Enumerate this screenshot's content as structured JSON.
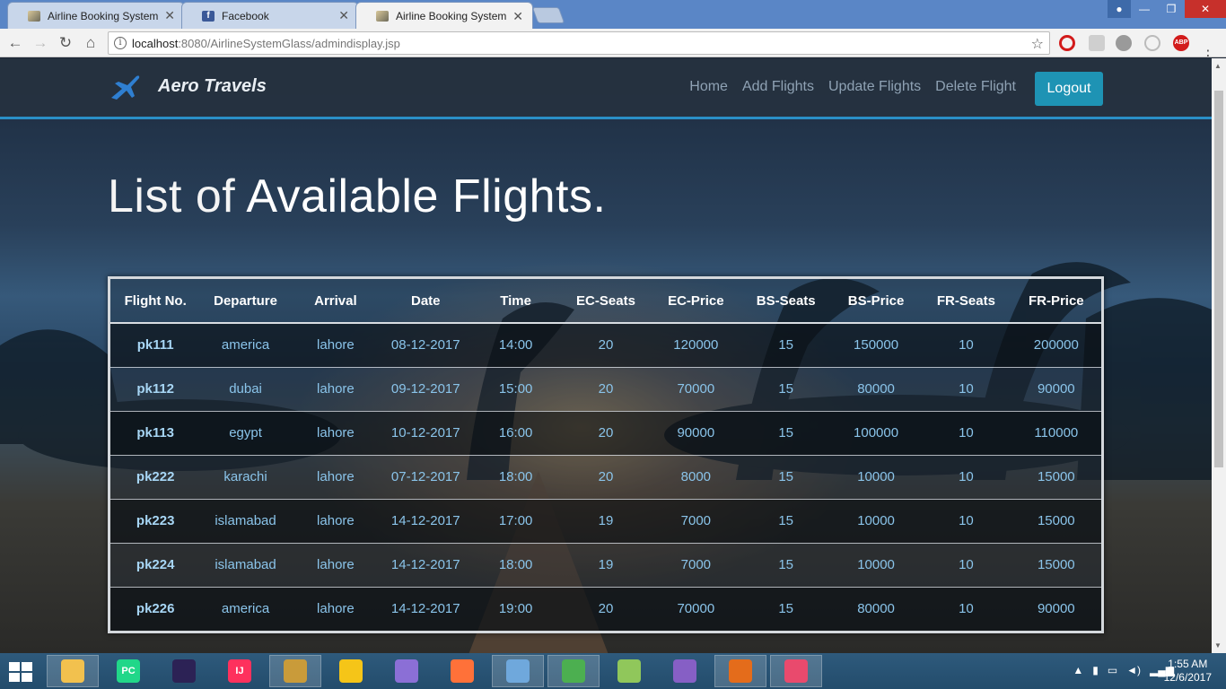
{
  "browser": {
    "tabs": [
      {
        "title": "Airline Booking System",
        "favicon": "plane-favicon",
        "active": false
      },
      {
        "title": "Facebook",
        "favicon": "facebook-favicon",
        "active": false
      },
      {
        "title": "Airline Booking System",
        "favicon": "plane-favicon",
        "active": true
      }
    ],
    "url_host": "localhost",
    "url_rest": ":8080/AirlineSystemGlass/admindisplay.jsp",
    "abp_label": "ABP"
  },
  "site": {
    "brand": "Aero Travels",
    "nav": [
      "Home",
      "Add Flights",
      "Update Flights",
      "Delete Flight"
    ],
    "logout": "Logout",
    "headline_light": "List of ",
    "headline_bold": "Available Flights",
    "headline_end": "."
  },
  "table": {
    "headers": [
      "Flight No.",
      "Departure",
      "Arrival",
      "Date",
      "Time",
      "EC-Seats",
      "EC-Price",
      "BS-Seats",
      "BS-Price",
      "FR-Seats",
      "FR-Price"
    ],
    "rows": [
      [
        "pk111",
        "america",
        "lahore",
        "08-12-2017",
        "14:00",
        "20",
        "120000",
        "15",
        "150000",
        "10",
        "200000"
      ],
      [
        "pk112",
        "dubai",
        "lahore",
        "09-12-2017",
        "15:00",
        "20",
        "70000",
        "15",
        "80000",
        "10",
        "90000"
      ],
      [
        "pk113",
        "egypt",
        "lahore",
        "10-12-2017",
        "16:00",
        "20",
        "90000",
        "15",
        "100000",
        "10",
        "110000"
      ],
      [
        "pk222",
        "karachi",
        "lahore",
        "07-12-2017",
        "18:00",
        "20",
        "8000",
        "15",
        "10000",
        "10",
        "15000"
      ],
      [
        "pk223",
        "islamabad",
        "lahore",
        "14-12-2017",
        "17:00",
        "19",
        "7000",
        "15",
        "10000",
        "10",
        "15000"
      ],
      [
        "pk224",
        "islamabad",
        "lahore",
        "14-12-2017",
        "18:00",
        "19",
        "7000",
        "15",
        "10000",
        "10",
        "15000"
      ],
      [
        "pk226",
        "america",
        "lahore",
        "14-12-2017",
        "19:00",
        "20",
        "70000",
        "15",
        "80000",
        "10",
        "90000"
      ]
    ]
  },
  "taskbar": {
    "apps": [
      {
        "name": "file-explorer",
        "label": "",
        "color": "#f2c14e"
      },
      {
        "name": "pycharm",
        "label": "PC",
        "color": "#21d789"
      },
      {
        "name": "eclipse",
        "label": "",
        "color": "#2c2255"
      },
      {
        "name": "intellij",
        "label": "IJ",
        "color": "#fe315d"
      },
      {
        "name": "tools",
        "label": "",
        "color": "#c99b3a"
      },
      {
        "name": "app-yellow",
        "label": "",
        "color": "#f5c518"
      },
      {
        "name": "app-purple",
        "label": "",
        "color": "#8b6fd6"
      },
      {
        "name": "firefox",
        "label": "",
        "color": "#ff7139"
      },
      {
        "name": "virtualbox",
        "label": "",
        "color": "#6fa8dc"
      },
      {
        "name": "chrome",
        "label": "",
        "color": "#4caf50"
      },
      {
        "name": "notepad-plus",
        "label": "",
        "color": "#90c75b"
      },
      {
        "name": "visual-studio",
        "label": "",
        "color": "#865fc5"
      },
      {
        "name": "matlab",
        "label": "",
        "color": "#e46c1b"
      },
      {
        "name": "star-app",
        "label": "",
        "color": "#e94a6d"
      }
    ],
    "time": "1:55 AM",
    "date": "12/6/2017"
  }
}
